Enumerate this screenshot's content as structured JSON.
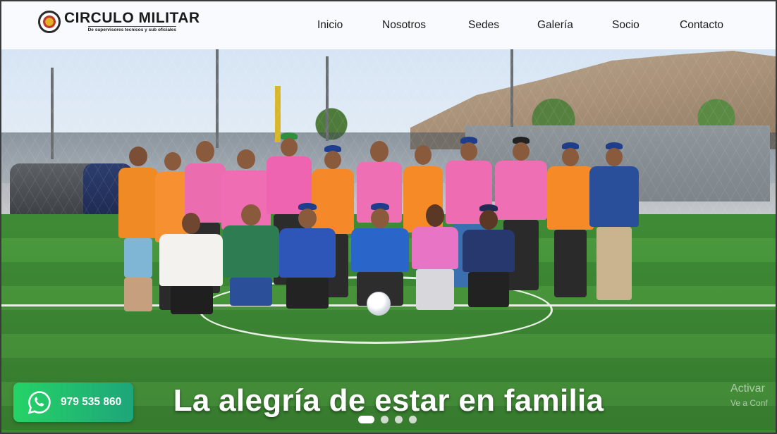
{
  "brand": {
    "title": "CIRCULO MILITAR",
    "subtitle": "De supervisores tecnicos y sub oficiales"
  },
  "nav": {
    "items": [
      {
        "label": "Inicio"
      },
      {
        "label": "Nosotros"
      },
      {
        "label": "Sedes"
      },
      {
        "label": "Galería"
      },
      {
        "label": "Socio"
      },
      {
        "label": "Contacto"
      }
    ]
  },
  "hero": {
    "caption": "La alegría de estar en familia",
    "photo_subject": "group-photo-soccer-field",
    "slides_total": 4,
    "active_slide": 1
  },
  "whatsapp": {
    "number": "979 535 860",
    "icon": "whatsapp-icon",
    "color": "#25d366"
  },
  "watermark": {
    "line1": "Activar",
    "line2": "Ve a Conf"
  }
}
